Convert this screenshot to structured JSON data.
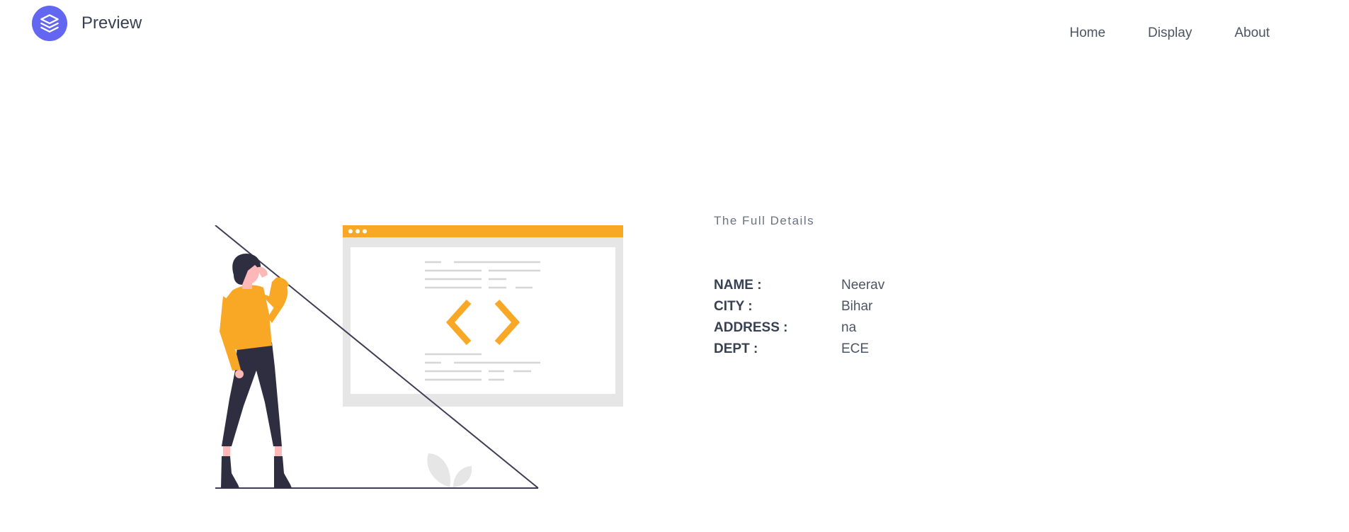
{
  "header": {
    "brand": "Preview",
    "logo_icon": "stack-layers-icon",
    "accent": "#6366f1",
    "nav": [
      {
        "label": "Home"
      },
      {
        "label": "Display"
      },
      {
        "label": "About"
      }
    ]
  },
  "details": {
    "heading": "The Full Details",
    "rows": [
      {
        "label": "NAME :",
        "value": "Neerav"
      },
      {
        "label": "CITY :",
        "value": "Bihar"
      },
      {
        "label": "ADDRESS :",
        "value": "na"
      },
      {
        "label": "DEPT :",
        "value": "ECE"
      }
    ]
  },
  "illustration": {
    "icon": "developer-code-window-illustration",
    "accent": "#f9a826"
  }
}
